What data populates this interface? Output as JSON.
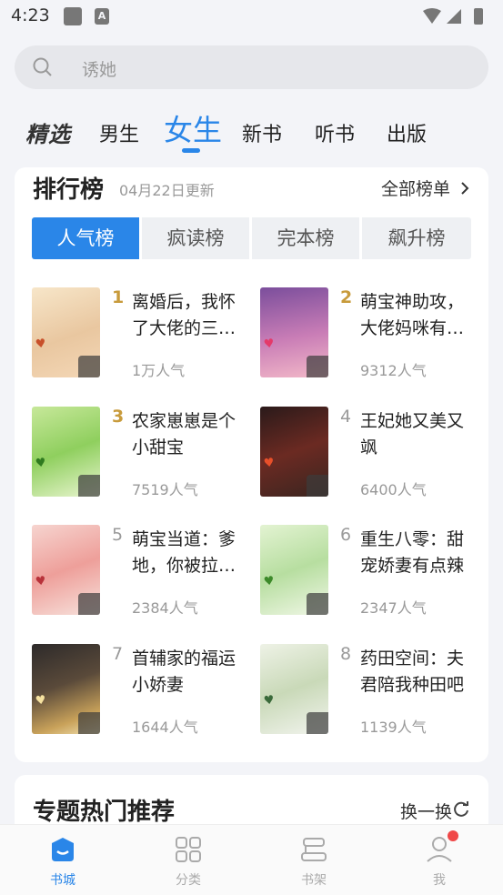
{
  "status_bar": {
    "time": "4:23"
  },
  "search": {
    "placeholder": "诱她"
  },
  "top_tabs": [
    "精选",
    "男生",
    "女生",
    "新书",
    "听书",
    "出版"
  ],
  "ranking": {
    "title": "排行榜",
    "updated": "04月22日更新",
    "all_link": "全部榜单",
    "segments": [
      "人气榜",
      "疯读榜",
      "完本榜",
      "飙升榜"
    ],
    "books": [
      {
        "rank": "1",
        "title": "离婚后，我怀了大佬的三…",
        "popularity": "1万人气"
      },
      {
        "rank": "2",
        "title": "萌宝神助攻，大佬妈咪有…",
        "popularity": "9312人气"
      },
      {
        "rank": "3",
        "title": "农家崽崽是个小甜宝",
        "popularity": "7519人气"
      },
      {
        "rank": "4",
        "title": "王妃她又美又飒",
        "popularity": "6400人气"
      },
      {
        "rank": "5",
        "title": "萌宝当道：爹地，你被拉…",
        "popularity": "2384人气"
      },
      {
        "rank": "6",
        "title": "重生八零：甜宠娇妻有点辣",
        "popularity": "2347人气"
      },
      {
        "rank": "7",
        "title": "首辅家的福运小娇妻",
        "popularity": "1644人气"
      },
      {
        "rank": "8",
        "title": "药田空间：夫君陪我种田吧",
        "popularity": "1139人气"
      }
    ]
  },
  "topic": {
    "title": "专题热门推荐",
    "refresh": "换一换"
  },
  "bottom_nav": [
    "书城",
    "分类",
    "书架",
    "我"
  ],
  "colors": {
    "accent": "#2a86e8",
    "rank_gold": "#c89b3c",
    "badge": "#f04848"
  }
}
